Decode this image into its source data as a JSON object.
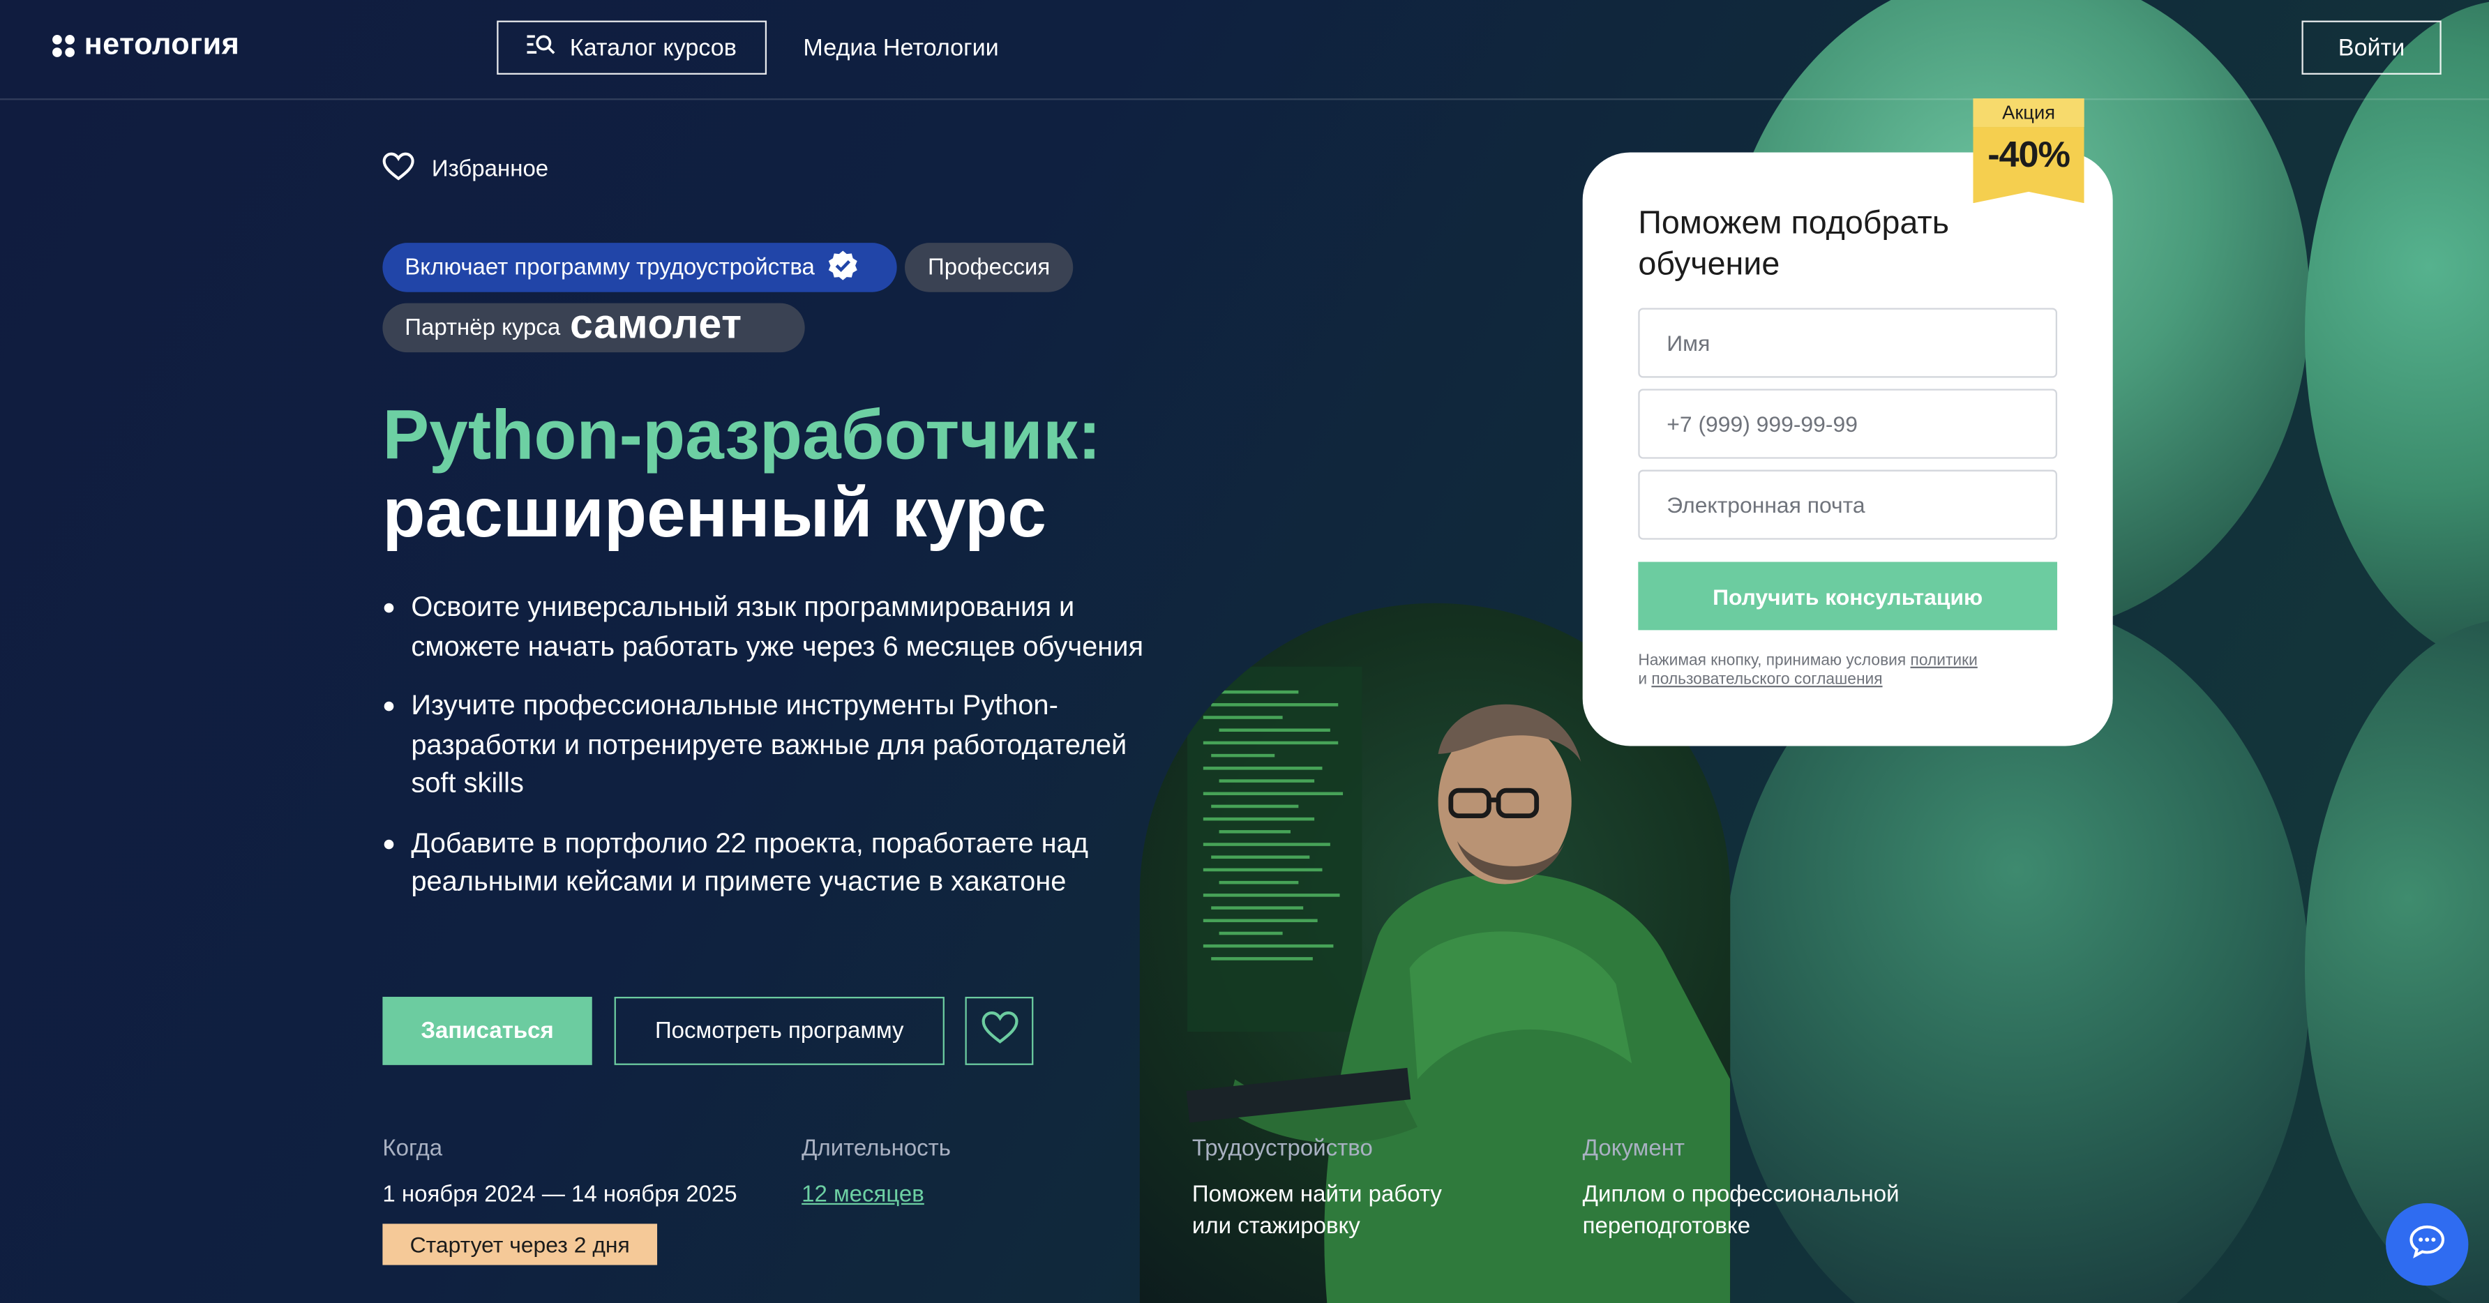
{
  "header": {
    "logo_text": "нетология",
    "catalog_label": "Каталог курсов",
    "media_label": "Медиа Нетологии",
    "login_label": "Войти"
  },
  "favorites_label": "Избранное",
  "badges": {
    "employment": "Включает программу трудоустройства",
    "profession": "Профессия",
    "partner_prefix": "Партнёр курса",
    "partner_brand": "самолет"
  },
  "title": {
    "line1": "Python-разработчик:",
    "line2": "расширенный курс"
  },
  "bullets": [
    "Освоите универсальный язык программирования и сможете начать работать уже через 6 месяцев обучения",
    "Изучите профессиональные инструменты Python-разработки и потренируете важные для работодателей soft skills",
    "Добавите в портфолио 22 проекта, поработаете над реальными кейсами и примете участие в хакатоне"
  ],
  "actions": {
    "enroll_label": "Записаться",
    "program_label": "Посмотреть программу"
  },
  "info": {
    "when_label": "Когда",
    "when_value": "1 ноября 2024 — 14 ноября 2025",
    "start_badge": "Стартует через 2 дня",
    "duration_label": "Длительность",
    "duration_value": "12 месяцев",
    "employment_label": "Трудоустройство",
    "employment_value_1": "Поможем найти работу",
    "employment_value_2": "или стажировку",
    "document_label": "Документ",
    "document_value_1": "Диплом о профессиональной",
    "document_value_2": "переподготовке"
  },
  "form": {
    "title_1": "Поможем подобрать",
    "title_2": "обучение",
    "name_placeholder": "Имя",
    "phone_placeholder": "+7 (999) 999-99-99",
    "email_placeholder": "Электронная почта",
    "submit_label": "Получить консультацию",
    "legal_prefix": "Нажимая кнопку, принимаю условия ",
    "legal_policy": "политики",
    "legal_and": "и ",
    "legal_agreement": "пользовательского соглашения"
  },
  "promo": {
    "label": "Акция",
    "discount": "-40%"
  },
  "colors": {
    "accent_green": "#6ccca0",
    "title_green": "#6dd0a3",
    "badge_blue": "#2145a8",
    "promo_yellow": "#f5cf4f",
    "start_badge_peach": "#f5c998",
    "chat_blue": "#2f6cf1"
  },
  "icons": {
    "catalog": "catalog-search-icon",
    "favorites": "heart-icon",
    "verified": "verified-check-icon",
    "chat": "chat-bubble-icon"
  }
}
